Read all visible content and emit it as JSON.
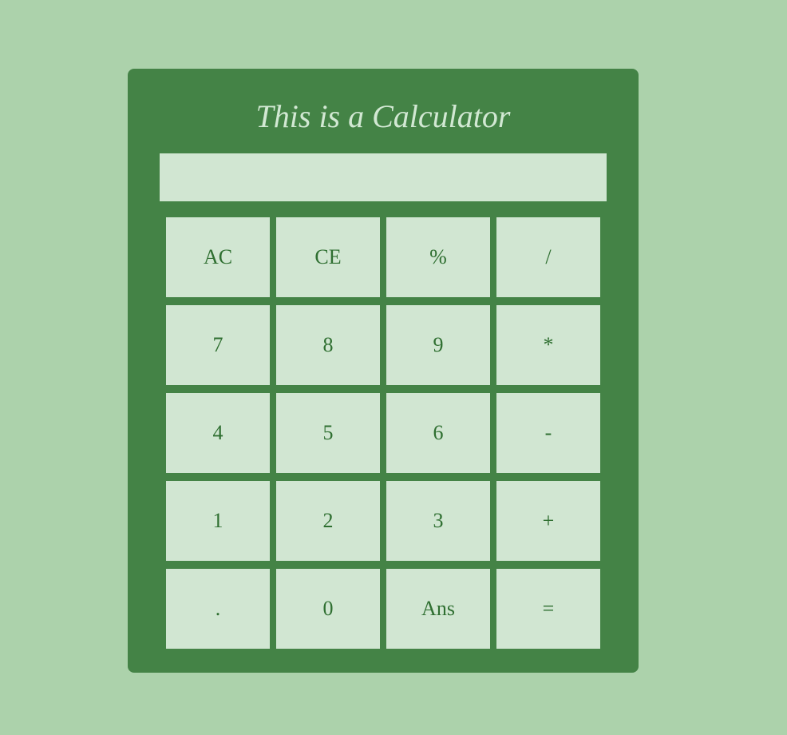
{
  "calculator": {
    "title": "This is a Calculator",
    "display": {
      "value": "",
      "placeholder": ""
    },
    "keys": [
      [
        "AC",
        "CE",
        "%",
        "/"
      ],
      [
        "7",
        "8",
        "9",
        "*"
      ],
      [
        "4",
        "5",
        "6",
        "-"
      ],
      [
        "1",
        "2",
        "3",
        "+"
      ],
      [
        ".",
        "0",
        "Ans",
        "="
      ]
    ]
  },
  "colors": {
    "page_background": "#acd2ab",
    "calculator_body": "#448346",
    "key_background": "#d1e6d2",
    "key_text": "#2f6f31",
    "title_text": "#d2e8d3"
  }
}
